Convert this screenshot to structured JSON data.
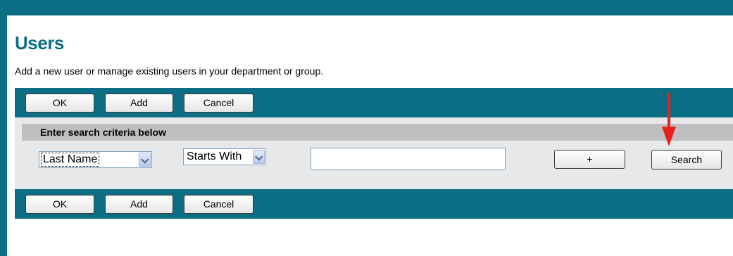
{
  "header": {
    "title": "Users",
    "subtitle": "Add a new user or manage existing users in your department or group."
  },
  "toolbar": {
    "ok_label": "OK",
    "add_label": "Add",
    "cancel_label": "Cancel"
  },
  "search": {
    "header_label": "Enter search criteria below",
    "field_select": {
      "selected": "Last Name"
    },
    "operator_select": {
      "selected": "Starts With"
    },
    "query_input": {
      "value": "",
      "placeholder": ""
    },
    "add_criteria_label": "+",
    "search_label": "Search"
  },
  "colors": {
    "teal": "#0b6e84",
    "panel_bg": "#e6e8e9",
    "header_bar": "#bfbfbf",
    "annotation_arrow": "#e8201c"
  },
  "icons": {
    "dropdown": "chevron-down-icon",
    "annotation": "red-arrow-icon"
  }
}
